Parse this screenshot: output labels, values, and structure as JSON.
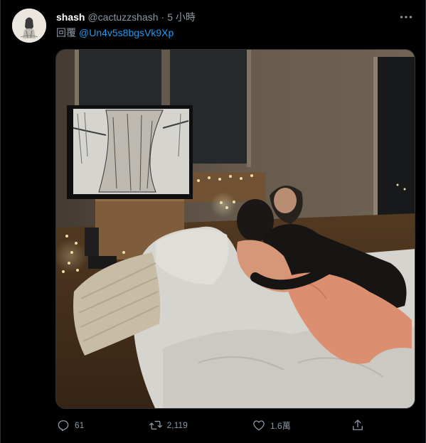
{
  "tweet": {
    "author_name": "shash",
    "author_handle": "@cactuzzshash",
    "separator": "·",
    "timestamp": "5 小時",
    "reply_prefix": "回覆",
    "reply_mention": "@Un4v5s8bgsVk9Xp",
    "media_alt": "couple cuddling on floor mattress watching a drawing of a tree on a TV, fairy lights around"
  },
  "actions": {
    "reply_count": "61",
    "retweet_count": "2,119",
    "like_count": "1.6萬",
    "share_label": ""
  },
  "colors": {
    "background": "#000000",
    "name": "#ffffff",
    "secondary": "#8b98a5",
    "link": "#1d9bf0",
    "border": "#2f3336"
  },
  "icons": {
    "more": "more-horizontal-icon",
    "reply": "comment-icon",
    "retweet": "retweet-icon",
    "like": "heart-icon",
    "share": "share-icon"
  }
}
